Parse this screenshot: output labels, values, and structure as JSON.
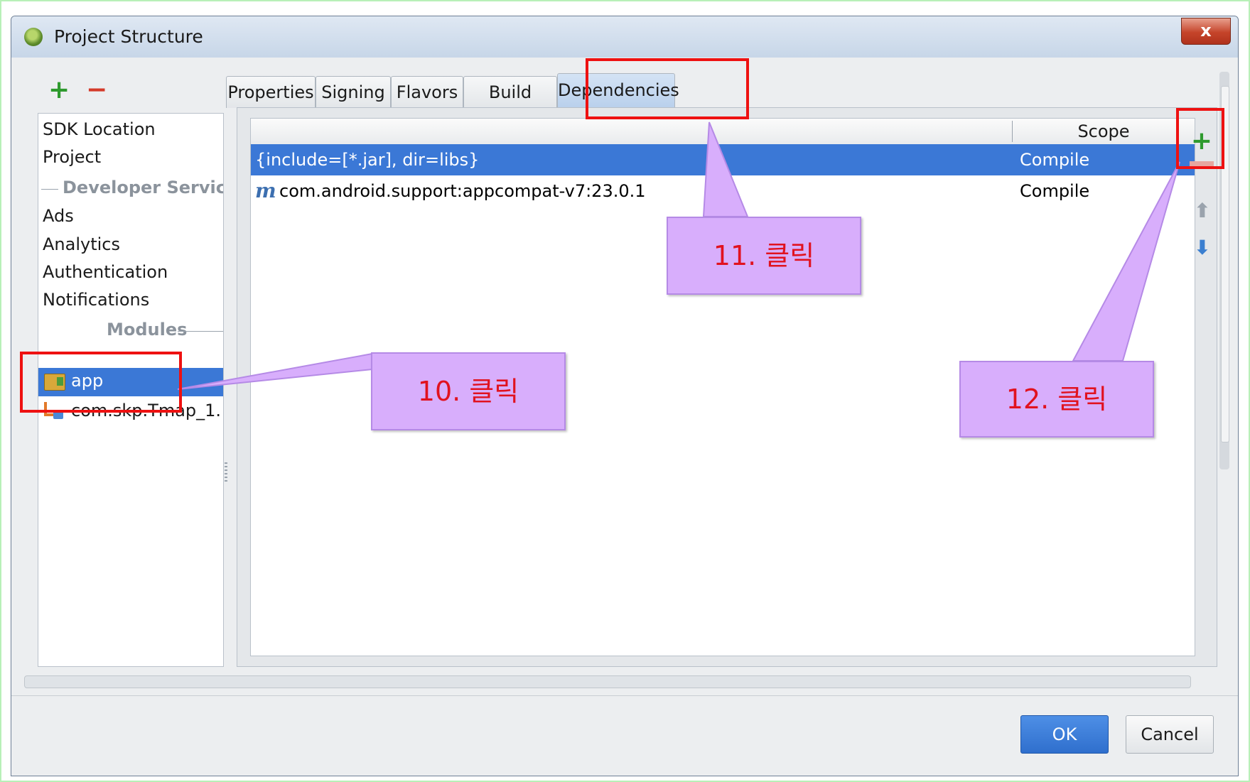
{
  "window": {
    "title": "Project Structure",
    "close_label": "x"
  },
  "left_panel": {
    "add_label": "+",
    "remove_label": "−",
    "items": [
      {
        "label": "SDK Location"
      },
      {
        "label": "Project"
      },
      {
        "label": "Ads"
      },
      {
        "label": "Analytics"
      },
      {
        "label": "Authentication"
      },
      {
        "label": "Notifications"
      }
    ],
    "section_developer_services": "Developer Service",
    "section_modules": "Modules",
    "modules": [
      {
        "label": "app",
        "selected": true
      },
      {
        "label": "com.skp.Tmap_1."
      }
    ]
  },
  "tabs": [
    {
      "label": "Properties"
    },
    {
      "label": "Signing"
    },
    {
      "label": "Flavors"
    },
    {
      "label": "Build Types"
    },
    {
      "label": "Dependencies",
      "active": true
    }
  ],
  "table": {
    "scope_header": "Scope",
    "rows": [
      {
        "dependency": "{include=[*.jar], dir=libs}",
        "scope": "Compile",
        "selected": true
      },
      {
        "icon": "m",
        "dependency": "com.android.support:appcompat-v7:23.0.1",
        "scope": "Compile"
      }
    ]
  },
  "side_toolbar": {
    "add_label": "+",
    "up_label": "⬆",
    "down_label": "⬇"
  },
  "buttons": {
    "ok": "OK",
    "cancel": "Cancel"
  },
  "annotations": {
    "step10": "10. 클릭",
    "step11": "11. 클릭",
    "step12": "12. 클릭"
  },
  "colors": {
    "selection": "#3b78d6",
    "annotation_red": "#ee1111",
    "callout_fill": "#d8aefc",
    "callout_text": "#e1121f"
  }
}
